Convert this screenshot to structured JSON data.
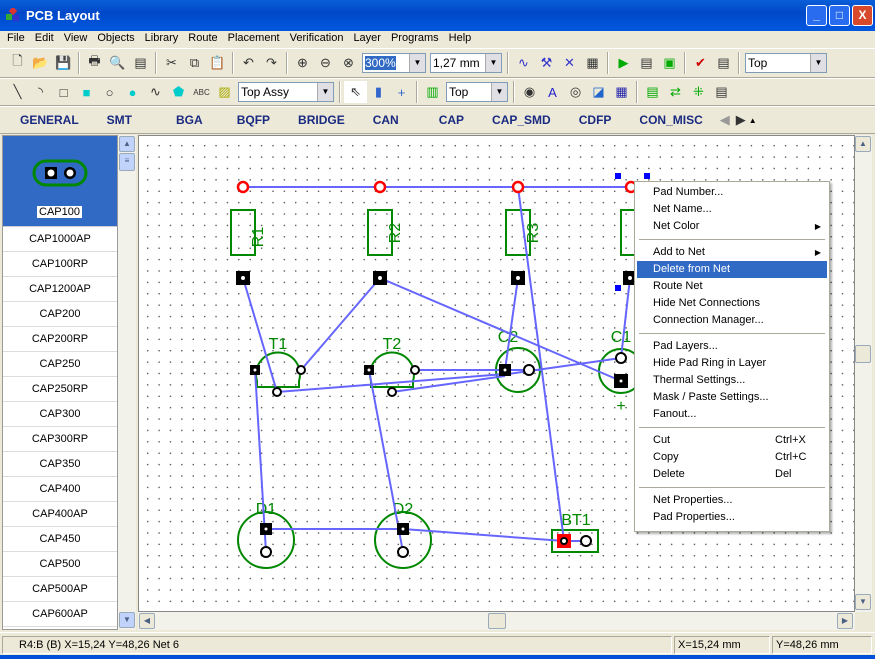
{
  "window": {
    "title": "PCB Layout",
    "controls": [
      "_",
      "□",
      "X"
    ]
  },
  "menu": [
    "File",
    "Edit",
    "View",
    "Objects",
    "Library",
    "Route",
    "Placement",
    "Verification",
    "Layer",
    "Programs",
    "Help"
  ],
  "toolbar1": {
    "zoom": "300%",
    "grid": "1,27 mm",
    "layer": "Top"
  },
  "toolbar2": {
    "draw_layer": "Top Assy",
    "pad_layer": "Top",
    "text_tool": "ABC"
  },
  "library_tabs": [
    "GENERAL",
    "SMT",
    "BGA",
    "BQFP",
    "BRIDGE",
    "CAN",
    "CAP",
    "CAP_SMD",
    "CDFP",
    "CON_MISC"
  ],
  "library_list": {
    "selected": "CAP100",
    "items": [
      "CAP1000AP",
      "CAP100RP",
      "CAP1200AP",
      "CAP200",
      "CAP200RP",
      "CAP250",
      "CAP250RP",
      "CAP300",
      "CAP300RP",
      "CAP350",
      "CAP400",
      "CAP400AP",
      "CAP450",
      "CAP500",
      "CAP500AP",
      "CAP600AP"
    ]
  },
  "components": {
    "r1": "R1",
    "r2": "R2",
    "r3": "R3",
    "t1": "T1",
    "t2": "T2",
    "c1": "C1",
    "c2": "C2",
    "d1": "D1",
    "d2": "D2",
    "bt1": "BT1",
    "plus": "+"
  },
  "colors": {
    "silk": "#008800",
    "net": "#6666ff",
    "selected_pad": "#ff0000",
    "highlight": "#316ac5"
  },
  "context_menu": [
    {
      "label": "Pad Number..."
    },
    {
      "label": "Net Name..."
    },
    {
      "label": "Net Color",
      "submenu": true
    },
    {
      "sep": true
    },
    {
      "label": "Add to Net",
      "submenu": true
    },
    {
      "label": "Delete from Net",
      "highlighted": true
    },
    {
      "label": "Route Net"
    },
    {
      "label": "Hide Net Connections"
    },
    {
      "label": "Connection Manager..."
    },
    {
      "sep": true
    },
    {
      "label": "Pad Layers..."
    },
    {
      "label": "Hide Pad Ring in Layer"
    },
    {
      "label": "Thermal Settings..."
    },
    {
      "label": "Mask / Paste Settings..."
    },
    {
      "label": "Fanout..."
    },
    {
      "sep": true
    },
    {
      "label": "Cut",
      "shortcut": "Ctrl+X"
    },
    {
      "label": "Copy",
      "shortcut": "Ctrl+C"
    },
    {
      "label": "Delete",
      "shortcut": "Del"
    },
    {
      "sep": true
    },
    {
      "label": "Net Properties..."
    },
    {
      "label": "Pad Properties..."
    }
  ],
  "status": {
    "info": "R4:B (B)  X=15,24  Y=48,26   Net 6",
    "x": "X=15,24 mm",
    "y": "Y=48,26 mm"
  }
}
